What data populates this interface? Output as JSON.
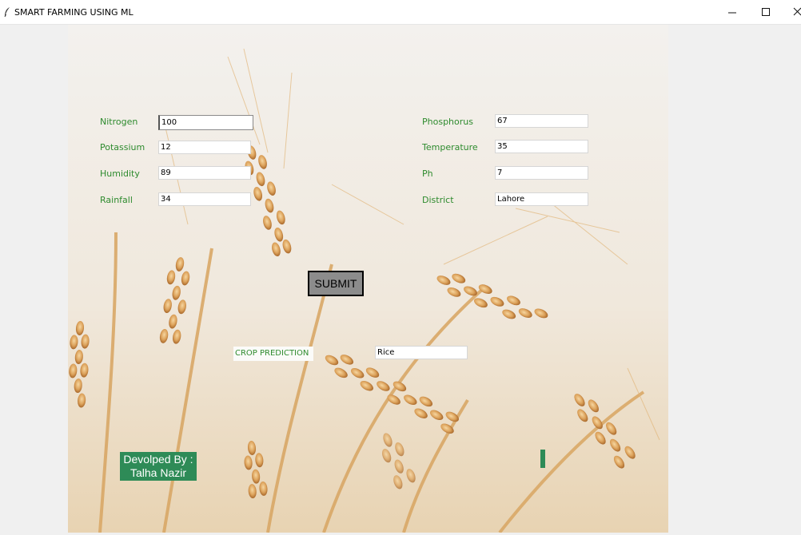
{
  "window": {
    "title": "SMART FARMING USING ML"
  },
  "form": {
    "left": [
      {
        "label": "Nitrogen",
        "value": "100"
      },
      {
        "label": "Potassium",
        "value": "12"
      },
      {
        "label": "Humidity",
        "value": "89"
      },
      {
        "label": "Rainfall",
        "value": "34"
      }
    ],
    "right": [
      {
        "label": "Phosphorus",
        "value": "67"
      },
      {
        "label": "Temperature",
        "value": "35"
      },
      {
        "label": "Ph",
        "value": "7"
      },
      {
        "label": "District",
        "value": "Lahore"
      }
    ],
    "submit_label": "SUBMIT"
  },
  "result": {
    "label": "CROP PREDICTION",
    "value": "Rice"
  },
  "credit": {
    "line1": "Devolped By :",
    "line2": "Talha Nazir"
  },
  "colors": {
    "label_green": "#2e8b2e",
    "credit_bg": "#2e8b57",
    "button_bg": "#8c8c8c"
  }
}
